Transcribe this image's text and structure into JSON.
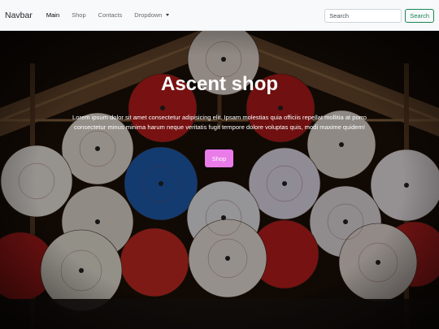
{
  "navbar": {
    "brand": "Navbar",
    "links": [
      {
        "label": "Main"
      },
      {
        "label": "Shop"
      },
      {
        "label": "Contacts"
      },
      {
        "label": "Dropdown"
      }
    ],
    "search": {
      "placeholder": "Search",
      "button_label": "Search"
    }
  },
  "hero": {
    "title": "Ascent shop",
    "text": "Lorem ipsum dolor sit amet consectetur adipisicing elit. Ipsam molestias quia officiis repellat mollitia at porro consectetur minus minima harum neque veritatis fugit tempore dolore voluptas quis, modi maxime quidem!",
    "button_label": "Shop",
    "button_color": "#e97ce9"
  },
  "icons": {
    "dropdown": "caret-down-icon"
  }
}
